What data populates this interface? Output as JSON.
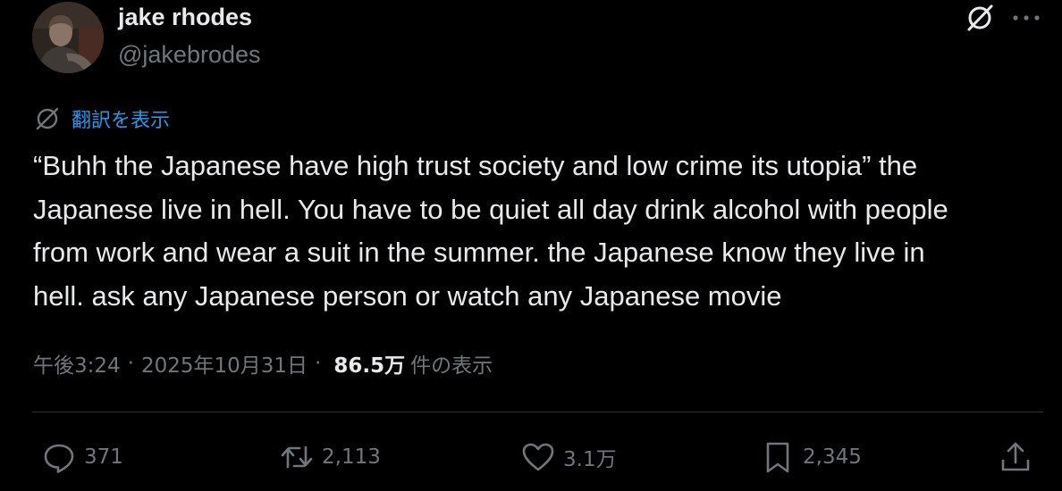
{
  "author": {
    "name": "jake rhodes",
    "handle": "@jakebrodes"
  },
  "header": {
    "grok_icon": "grok-icon",
    "more_icon": "more-icon"
  },
  "translate": {
    "icon": "translate-icon",
    "label": "翻訳を表示"
  },
  "tweet": {
    "lines": [
      "“Buhh the Japanese have high trust society and low crime its utopia” the",
      "Japanese live in hell. You have to be quiet all day drink alcohol with people",
      "from work and wear a suit in the summer. the Japanese know they live in",
      "hell. ask any Japanese person or watch any Japanese movie"
    ]
  },
  "meta": {
    "time": "午後3:24",
    "separator": "·",
    "date": "2025年10月31日",
    "views_count": "86.5万",
    "views_label": "件の表示"
  },
  "actions": {
    "reply": {
      "icon": "reply-icon",
      "count": "371"
    },
    "retweet": {
      "icon": "retweet-icon",
      "count": "2,113"
    },
    "like": {
      "icon": "heart-icon",
      "count": "3.1万"
    },
    "bookmark": {
      "icon": "bookmark-icon",
      "count": "2,345"
    },
    "share": {
      "icon": "share-icon"
    }
  },
  "colors": {
    "background": "#000000",
    "text": "#e7e9ea",
    "secondary": "#71767b",
    "link": "#1d9bf0",
    "divider": "#2f3336"
  }
}
